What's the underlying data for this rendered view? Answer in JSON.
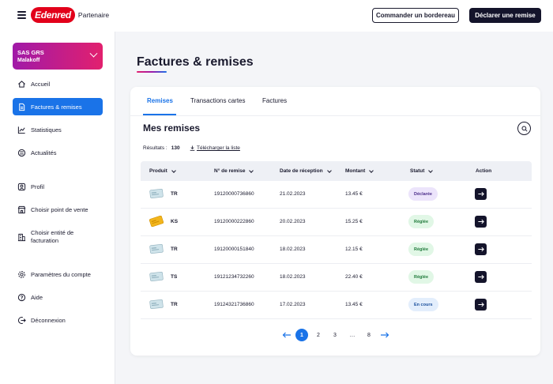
{
  "header": {
    "brand": "Edenred",
    "brand_sub": "Partenaire",
    "order_button": "Commander un bordereau",
    "declare_button": "Déclarer une remise"
  },
  "sidebar": {
    "account_name": "SAS GRS",
    "account_city": "Malakoff",
    "items": [
      {
        "label": "Accueil",
        "icon": "home-icon"
      },
      {
        "label": "Factures & remises",
        "icon": "document-icon",
        "active": true
      },
      {
        "label": "Statistiques",
        "icon": "chart-icon"
      },
      {
        "label": "Actualités",
        "icon": "news-icon"
      },
      {
        "label": "Profil",
        "icon": "user-icon"
      },
      {
        "label": "Choisir point de vente",
        "icon": "store-icon"
      },
      {
        "label": "Choisir entité de facturation",
        "icon": "building-icon"
      },
      {
        "label": "Paramètres du compte",
        "icon": "gear-icon"
      },
      {
        "label": "Aide",
        "icon": "help-icon"
      },
      {
        "label": "Déconnexion",
        "icon": "logout-icon"
      }
    ]
  },
  "main": {
    "title": "Factures & remises",
    "tabs": [
      "Remises",
      "Transactions cartes",
      "Factures"
    ],
    "section_title": "Mes remises",
    "results_label": "Résultats :",
    "results_count": "130",
    "download_label": "Télécharger la liste",
    "columns": [
      "Produit",
      "N° de remise",
      "Date de réception",
      "Montant",
      "Statut",
      "Action"
    ],
    "rows": [
      {
        "product": "TR",
        "number": "19120000736860",
        "date": "21.02.2023",
        "amount": "13.45 €",
        "status": "Déclarée",
        "status_color": "#ece4fb",
        "status_text_color": "#4b2c8a",
        "card": "blue"
      },
      {
        "product": "KS",
        "number": "19120000222860",
        "date": "20.02.2023",
        "amount": "15.25 €",
        "status": "Réglée",
        "status_color": "#e1f7e6",
        "status_text_color": "#1f7a3b",
        "card": "yellow"
      },
      {
        "product": "TR",
        "number": "19120000151840",
        "date": "18.02.2023",
        "amount": "12.15 €",
        "status": "Réglée",
        "status_color": "#e1f7e6",
        "status_text_color": "#1f7a3b",
        "card": "blue"
      },
      {
        "product": "TS",
        "number": "19121234732260",
        "date": "18.02.2023",
        "amount": "22.40 €",
        "status": "Réglée",
        "status_color": "#e1f7e6",
        "status_text_color": "#1f7a3b",
        "card": "blue"
      },
      {
        "product": "TR",
        "number": "19124321736860",
        "date": "17.02.2023",
        "amount": "13.45 €",
        "status": "En cours",
        "status_color": "#e3eefc",
        "status_text_color": "#1a4f9c",
        "card": "blue"
      }
    ],
    "pagination": {
      "pages": [
        "1",
        "2",
        "3",
        "…",
        "8"
      ],
      "current": "1"
    }
  },
  "colors": {
    "accent": "#1a73e8",
    "dark": "#14142b",
    "brand_red": "#e2001a"
  }
}
